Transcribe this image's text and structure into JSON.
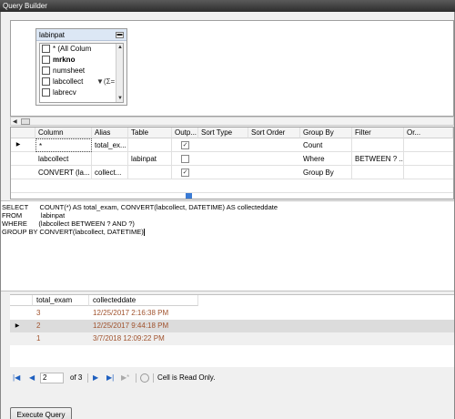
{
  "window": {
    "title": "Query Builder"
  },
  "diagram": {
    "table_name": "labinpat",
    "columns": [
      {
        "label": "* (All Colum",
        "bold": false,
        "checked": false
      },
      {
        "label": "mrkno",
        "bold": true,
        "checked": false
      },
      {
        "label": "numsheet",
        "bold": false,
        "checked": false
      },
      {
        "label": "labcollect",
        "bold": false,
        "checked": false
      },
      {
        "label": "labrecv",
        "bold": false,
        "checked": false
      }
    ]
  },
  "criteria": {
    "headers": [
      "Column",
      "Alias",
      "Table",
      "Outp...",
      "Sort Type",
      "Sort Order",
      "Group By",
      "Filter",
      "Or..."
    ],
    "rows": [
      {
        "column": "*",
        "alias": "total_ex...",
        "table": "",
        "output": true,
        "sort_type": "",
        "sort_order": "",
        "group_by": "Count",
        "filter": ""
      },
      {
        "column": "labcollect",
        "alias": "",
        "table": "labinpat",
        "output": false,
        "sort_type": "",
        "sort_order": "",
        "group_by": "Where",
        "filter": "BETWEEN ? ..."
      },
      {
        "column": "CONVERT (la...",
        "alias": "collect...",
        "table": "",
        "output": true,
        "sort_type": "",
        "sort_order": "",
        "group_by": "Group By",
        "filter": ""
      }
    ]
  },
  "sql": {
    "lines": [
      "SELECT      COUNT(*) AS total_exam, CONVERT(labcollect, DATETIME) AS collecteddate",
      "FROM          labinpat",
      "WHERE      (labcollect BETWEEN ? AND ?)",
      "GROUP BY CONVERT(labcollect, DATETIME)"
    ]
  },
  "results": {
    "headers": [
      "total_exam",
      "collecteddate"
    ],
    "rows": [
      {
        "total_exam": "3",
        "collecteddate": "12/25/2017 2:16:38 PM"
      },
      {
        "total_exam": "2",
        "collecteddate": "12/25/2017 9:44:18 PM"
      },
      {
        "total_exam": "1",
        "collecteddate": "3/7/2018 12:09:22 PM"
      }
    ]
  },
  "navigator": {
    "current_page": "2",
    "of_text": "of 3",
    "status": "Cell is Read Only."
  },
  "execute_button": "Execute Query"
}
